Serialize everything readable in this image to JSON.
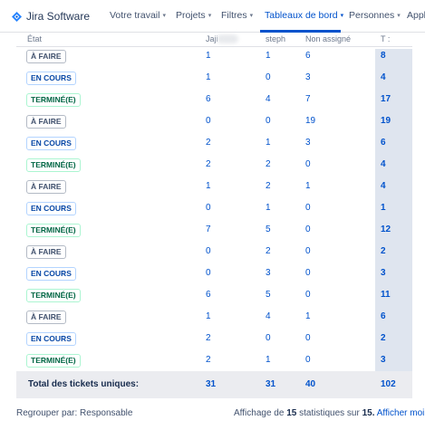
{
  "nav": {
    "logo_text": "Jira Software",
    "items": [
      {
        "label": "Votre travail"
      },
      {
        "label": "Projets"
      },
      {
        "label": "Filtres"
      },
      {
        "label": "Tableaux de bord"
      },
      {
        "label": "Personnes"
      },
      {
        "label": "Appl"
      }
    ],
    "active_color": "#0052cc"
  },
  "table": {
    "headers": {
      "status": "État",
      "col1": "Jaji",
      "col2": "steph",
      "col3": "Non assigné",
      "total": "T :"
    },
    "rows": [
      {
        "status": "À FAIRE",
        "kind": "todo",
        "c1": "1",
        "c2": "1",
        "c3": "6",
        "t": "8"
      },
      {
        "status": "EN COURS",
        "kind": "prog",
        "c1": "1",
        "c2": "0",
        "c3": "3",
        "t": "4"
      },
      {
        "status": "TERMINÉ(E)",
        "kind": "done",
        "c1": "6",
        "c2": "4",
        "c3": "7",
        "t": "17"
      },
      {
        "status": "À FAIRE",
        "kind": "todo",
        "c1": "0",
        "c2": "0",
        "c3": "19",
        "t": "19"
      },
      {
        "status": "EN COURS",
        "kind": "prog",
        "c1": "2",
        "c2": "1",
        "c3": "3",
        "t": "6"
      },
      {
        "status": "TERMINÉ(E)",
        "kind": "done",
        "c1": "2",
        "c2": "2",
        "c3": "0",
        "t": "4"
      },
      {
        "status": "À FAIRE",
        "kind": "todo",
        "c1": "1",
        "c2": "2",
        "c3": "1",
        "t": "4"
      },
      {
        "status": "EN COURS",
        "kind": "prog",
        "c1": "0",
        "c2": "1",
        "c3": "0",
        "t": "1"
      },
      {
        "status": "TERMINÉ(E)",
        "kind": "done",
        "c1": "7",
        "c2": "5",
        "c3": "0",
        "t": "12"
      },
      {
        "status": "À FAIRE",
        "kind": "todo",
        "c1": "0",
        "c2": "2",
        "c3": "0",
        "t": "2"
      },
      {
        "status": "EN COURS",
        "kind": "prog",
        "c1": "0",
        "c2": "3",
        "c3": "0",
        "t": "3"
      },
      {
        "status": "TERMINÉ(E)",
        "kind": "done",
        "c1": "6",
        "c2": "5",
        "c3": "0",
        "t": "11"
      },
      {
        "status": "À FAIRE",
        "kind": "todo",
        "c1": "1",
        "c2": "4",
        "c3": "1",
        "t": "6"
      },
      {
        "status": "EN COURS",
        "kind": "prog",
        "c1": "2",
        "c2": "0",
        "c3": "0",
        "t": "2"
      },
      {
        "status": "TERMINÉ(E)",
        "kind": "done",
        "c1": "2",
        "c2": "1",
        "c3": "0",
        "t": "3"
      }
    ],
    "totals": {
      "label": "Total des tickets uniques:",
      "c1": "31",
      "c2": "31",
      "c3": "40",
      "t": "102"
    }
  },
  "footer": {
    "group_by": "Regrouper par: Responsable",
    "showing_prefix": "Affichage de",
    "showing_count": "15",
    "showing_mid": "statistiques sur",
    "showing_total": "15.",
    "show_less": "Afficher moins"
  }
}
